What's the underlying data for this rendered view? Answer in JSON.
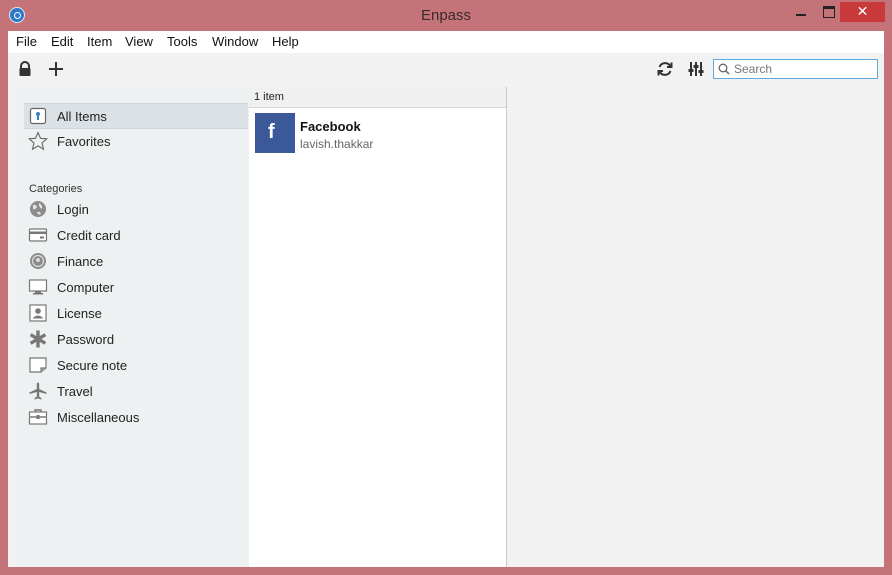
{
  "window": {
    "title": "Enpass"
  },
  "menu": [
    "File",
    "Edit",
    "Item",
    "View",
    "Tools",
    "Window",
    "Help"
  ],
  "toolbar": {
    "search_placeholder": "Search"
  },
  "sidebar": {
    "top_items": [
      {
        "label": "All Items",
        "icon": "vault-icon",
        "active": true
      },
      {
        "label": "Favorites",
        "icon": "star-icon",
        "active": false
      }
    ],
    "categories_heading": "Categories",
    "categories": [
      {
        "label": "Login",
        "icon": "globe-icon"
      },
      {
        "label": "Credit card",
        "icon": "credit-card-icon"
      },
      {
        "label": "Finance",
        "icon": "coin-icon"
      },
      {
        "label": "Computer",
        "icon": "monitor-icon"
      },
      {
        "label": "License",
        "icon": "id-badge-icon"
      },
      {
        "label": "Password",
        "icon": "asterisk-icon"
      },
      {
        "label": "Secure note",
        "icon": "note-icon"
      },
      {
        "label": "Travel",
        "icon": "airplane-icon"
      },
      {
        "label": "Miscellaneous",
        "icon": "toolbox-icon"
      }
    ]
  },
  "list": {
    "count_label": "1 item",
    "items": [
      {
        "title": "Facebook",
        "subtitle": "lavish.thakkar",
        "icon": "facebook-icon"
      }
    ]
  },
  "colors": {
    "window_frame": "#c47479",
    "close_button": "#c7393a",
    "facebook_blue": "#3b5998",
    "search_border": "#5fa9dd"
  }
}
